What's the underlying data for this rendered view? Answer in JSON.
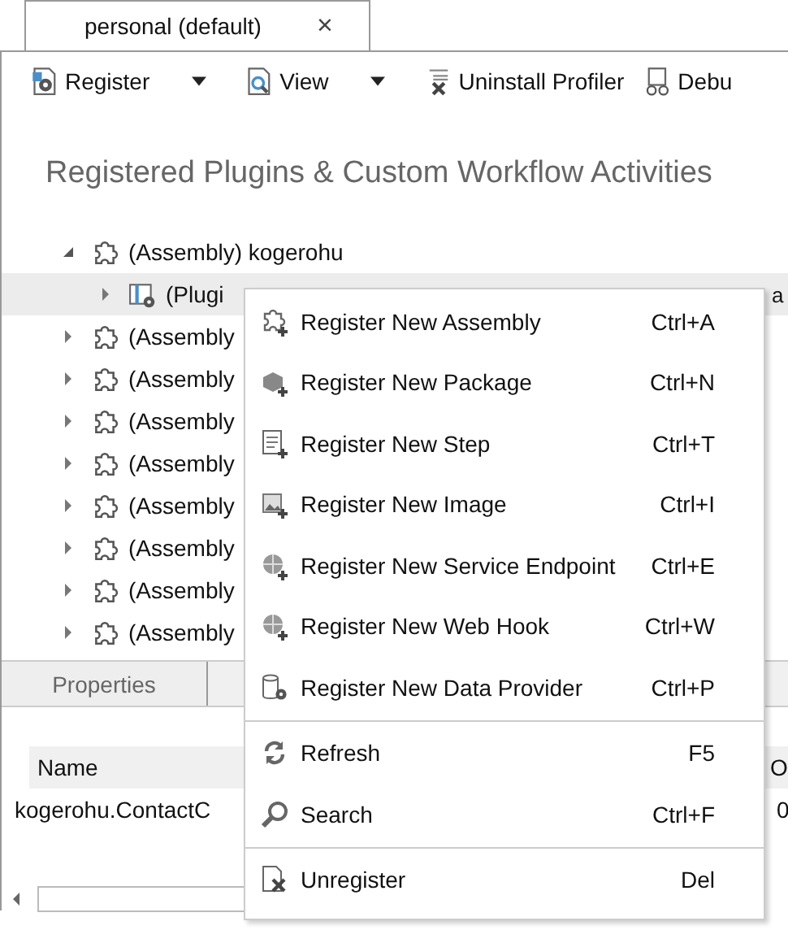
{
  "tab": {
    "title": "personal (default)",
    "close": "×"
  },
  "toolbar": [
    {
      "label": "Register",
      "kind": "register",
      "dropdown": true
    },
    {
      "label": "View",
      "kind": "view",
      "dropdown": true
    },
    {
      "label": "Uninstall Profiler",
      "kind": "uninstall",
      "dropdown": false
    },
    {
      "label": "Debu",
      "kind": "debug",
      "dropdown": false
    }
  ],
  "heading": "Registered Plugins & Custom Workflow Activities",
  "tree": [
    {
      "label": "(Assembly) kogerohu",
      "kind": "assembly",
      "expanded": true,
      "selected": false,
      "children": [
        {
          "label": "(Plugi",
          "tail": "a",
          "kind": "plugin",
          "expanded": false,
          "selected": true
        }
      ]
    },
    {
      "label": "(Assembly",
      "kind": "assembly",
      "expanded": false,
      "selected": false
    },
    {
      "label": "(Assembly",
      "kind": "assembly",
      "expanded": false,
      "selected": false
    },
    {
      "label": "(Assembly",
      "kind": "assembly",
      "expanded": false,
      "selected": false
    },
    {
      "label": "(Assembly",
      "kind": "assembly",
      "expanded": false,
      "selected": false
    },
    {
      "label": "(Assembly",
      "kind": "assembly",
      "expanded": false,
      "selected": false
    },
    {
      "label": "(Assembly",
      "kind": "assembly",
      "expanded": false,
      "selected": false
    },
    {
      "label": "(Assembly",
      "kind": "assembly",
      "expanded": false,
      "selected": false
    },
    {
      "label": "(Assembly",
      "kind": "assembly",
      "expanded": false,
      "selected": false
    }
  ],
  "properties": {
    "tab": "Properties",
    "columns": [
      "Name",
      "O"
    ],
    "row": [
      "kogerohu.ContactC",
      "0"
    ]
  },
  "menu": [
    [
      {
        "label": "Register New Assembly",
        "shortcut": "Ctrl+A",
        "kind": "assembly"
      },
      {
        "label": "Register New Package",
        "shortcut": "Ctrl+N",
        "kind": "package"
      },
      {
        "label": "Register New Step",
        "shortcut": "Ctrl+T",
        "kind": "step"
      },
      {
        "label": "Register New Image",
        "shortcut": "Ctrl+I",
        "kind": "image"
      },
      {
        "label": "Register New Service Endpoint",
        "shortcut": "Ctrl+E",
        "kind": "globe"
      },
      {
        "label": "Register New Web Hook",
        "shortcut": "Ctrl+W",
        "kind": "globe"
      },
      {
        "label": "Register New Data Provider",
        "shortcut": "Ctrl+P",
        "kind": "database"
      }
    ],
    [
      {
        "label": "Refresh",
        "shortcut": "F5",
        "kind": "refresh"
      },
      {
        "label": "Search",
        "shortcut": "Ctrl+F",
        "kind": "search"
      }
    ],
    [
      {
        "label": "Unregister",
        "shortcut": "Del",
        "kind": "unregister"
      }
    ]
  ]
}
